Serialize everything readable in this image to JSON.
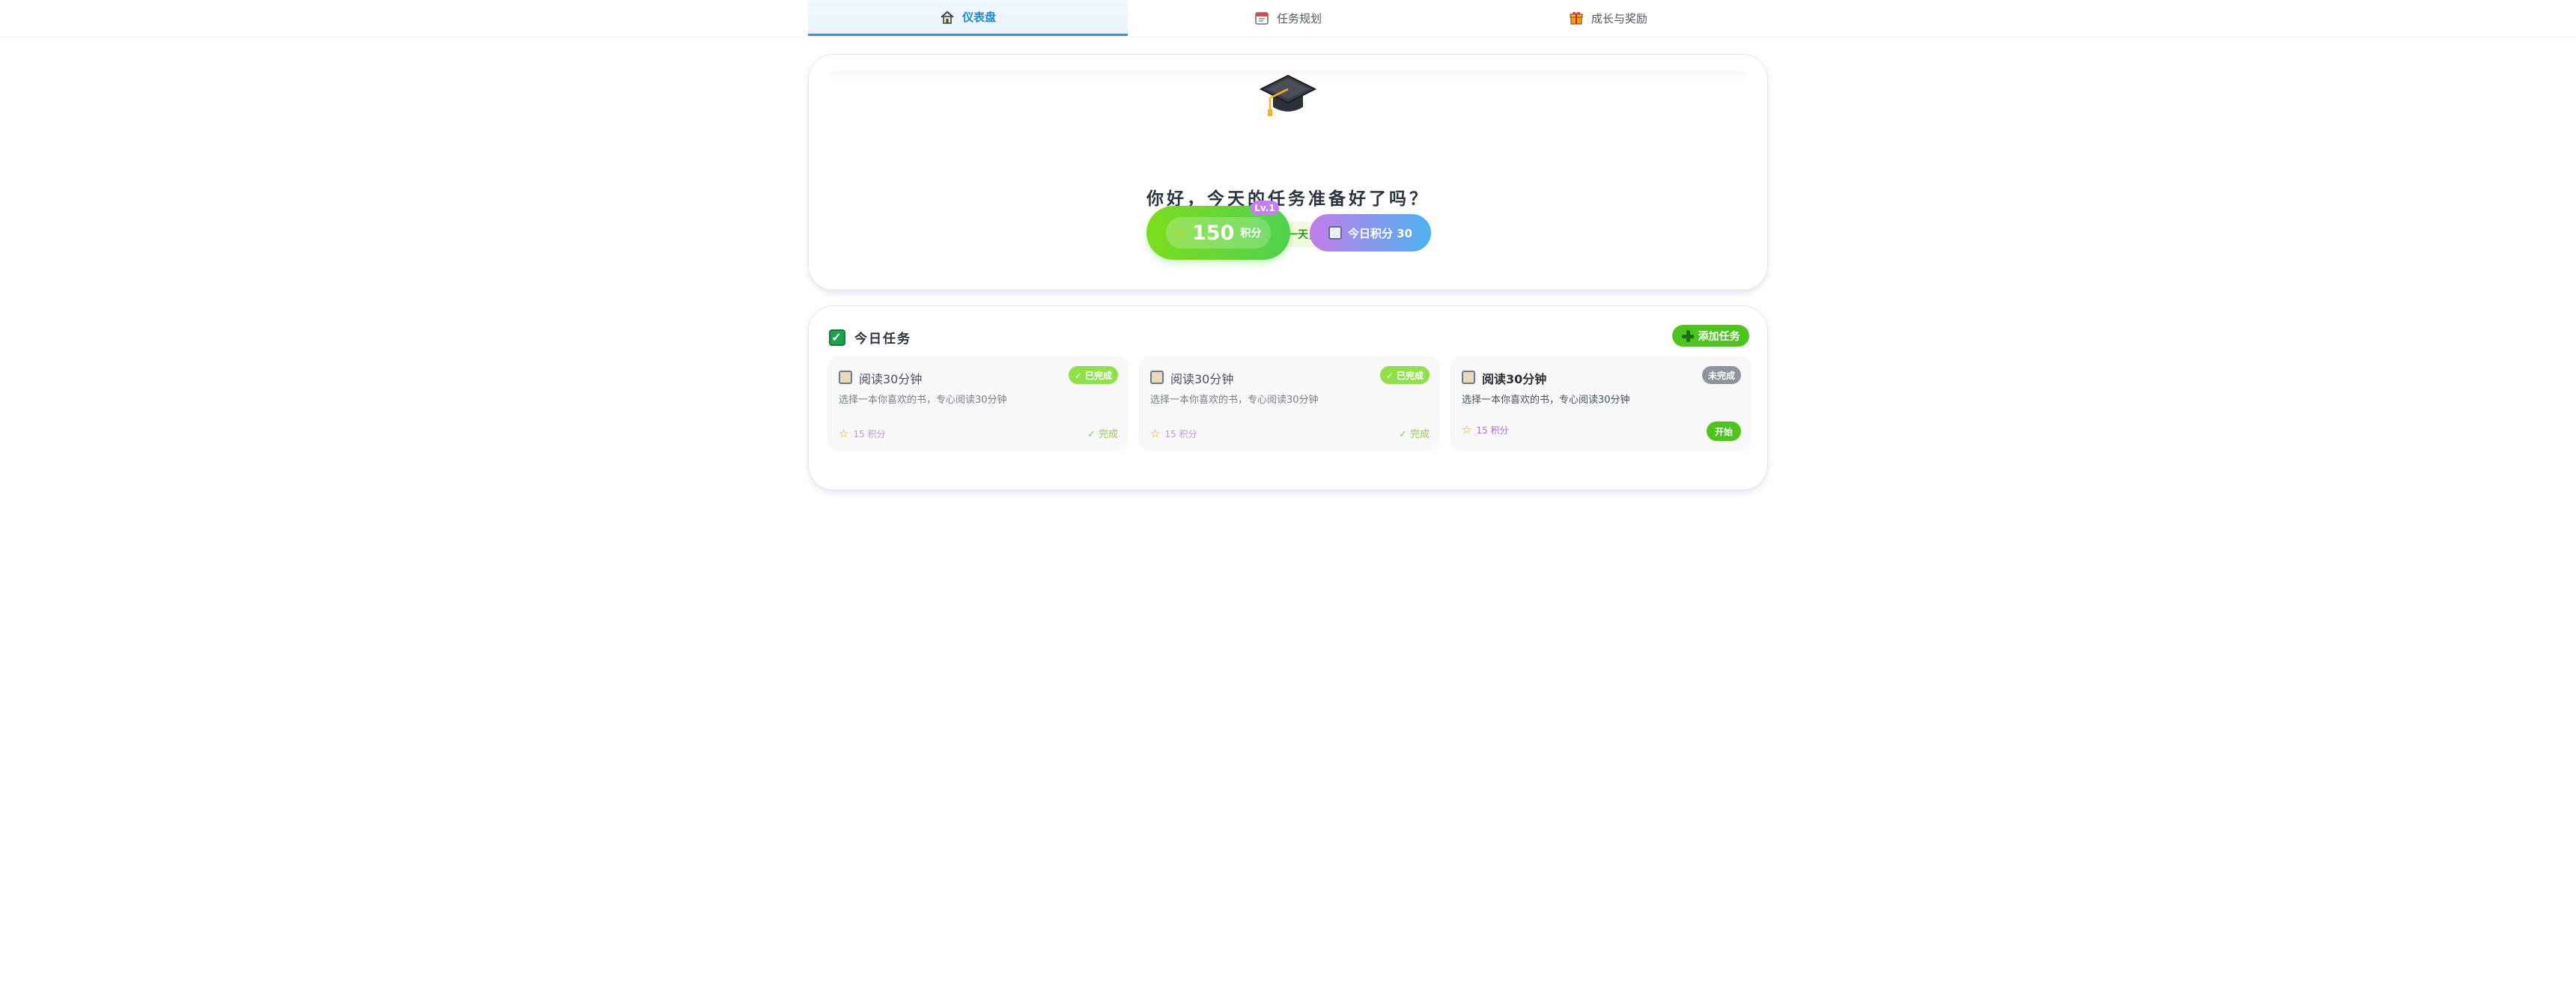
{
  "nav": {
    "tabs": [
      {
        "label": "仪表盘",
        "icon": "home-icon",
        "active": true
      },
      {
        "label": "任务规划",
        "icon": "calendar-icon",
        "active": false
      },
      {
        "label": "成长与奖励",
        "icon": "gift-icon",
        "active": false
      }
    ]
  },
  "hero": {
    "icon": "graduation-cap-icon",
    "greeting": "你好，今天的任务准备好了吗？",
    "morning_message": "早上好！新的一天，新的开始！",
    "total_points": "150",
    "points_unit": "积分",
    "level": "Lv.1",
    "today_points_label": "今日积分 30"
  },
  "tasks": {
    "title": "今日任务",
    "add_label": "添加任务",
    "items": [
      {
        "title": "阅读30分钟",
        "description": "选择一本你喜欢的书，专心阅读30分钟",
        "status": "✓ 已完成",
        "points": "15 积分",
        "action": "✓ 完成"
      },
      {
        "title": "阅读30分钟",
        "description": "选择一本你喜欢的书，专心阅读30分钟",
        "status": "✓ 已完成",
        "points": "15 积分",
        "action": "✓ 完成"
      },
      {
        "title": "阅读30分钟",
        "description": "选择一本你喜欢的书，专心阅读30分钟",
        "status": "未完成",
        "points": "15 积分",
        "action": "开始"
      }
    ]
  },
  "colors": {
    "accent_blue": "#2b97dd",
    "success_green": "#4ec41f",
    "done_badge": "#8fe14a",
    "todo_badge": "#8e949e",
    "level_purple": "#c77dec"
  }
}
